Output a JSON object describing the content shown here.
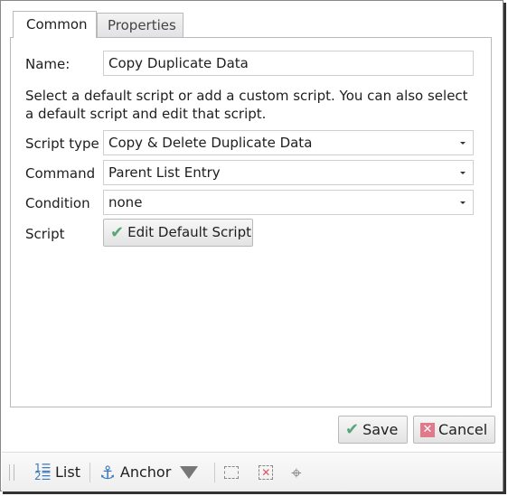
{
  "tabs": [
    {
      "label": "Common"
    },
    {
      "label": "Properties"
    }
  ],
  "form": {
    "name_label": "Name:",
    "name_value": "Copy Duplicate Data",
    "description": "Select a default script or add a custom script. You can also select a default script and edit that script.",
    "script_type_label": "Script type",
    "script_type_value": "Copy & Delete Duplicate Data",
    "command_label": "Command",
    "command_value": "Parent List Entry",
    "condition_label": "Condition",
    "condition_value": "none",
    "script_label": "Script",
    "edit_script_button": "Edit Default Script"
  },
  "actions": {
    "save": "Save",
    "cancel": "Cancel"
  },
  "toolbar": {
    "list": "List",
    "anchor": "Anchor"
  },
  "colors": {
    "check": "#5aa57a",
    "cancel": "#e07a8a",
    "anchor": "#3d78b8"
  }
}
